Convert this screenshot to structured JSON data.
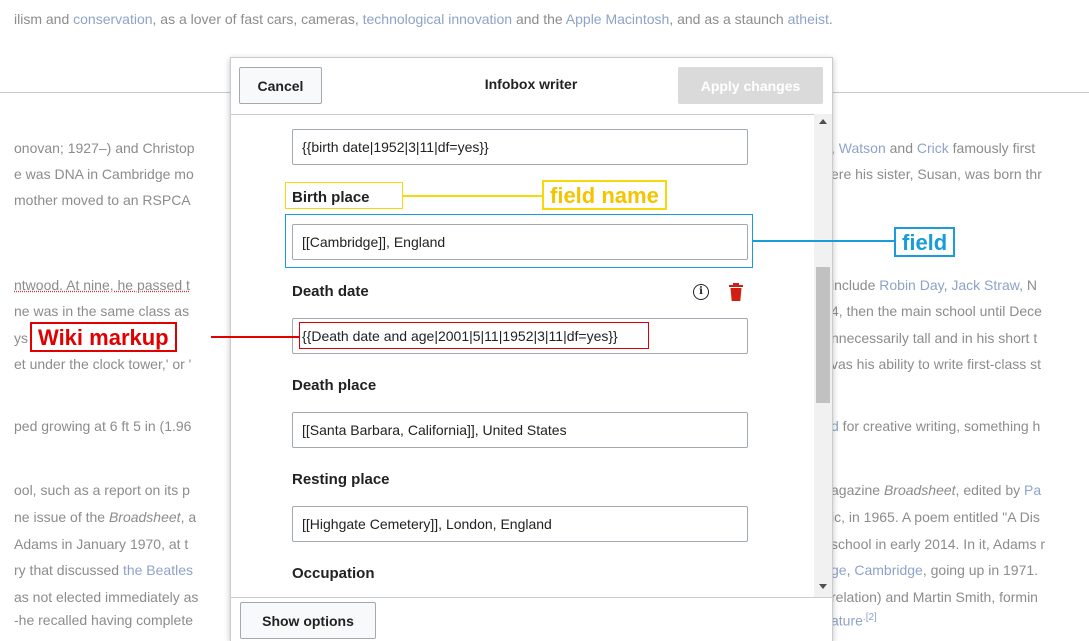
{
  "background": {
    "top_line": [
      {
        "t": "ilism and ",
        "l": false
      },
      {
        "t": "conservation",
        "l": true
      },
      {
        "t": ", as a lover of fast cars, cameras, ",
        "l": false
      },
      {
        "t": "technological innovation",
        "l": true
      },
      {
        "t": " and the ",
        "l": false
      },
      {
        "t": "Apple Macintosh",
        "l": true
      },
      {
        "t": ", and as a staunch ",
        "l": false
      },
      {
        "t": "atheist",
        "l": true
      },
      {
        "t": ".",
        "l": false
      }
    ],
    "left": [
      "onovan; 1927–) and Christop",
      "e was DNA in Cambridge mo",
      " mother moved to an ",
      "ntwood. At nine, he passed t",
      "ne was in the same class as",
      "ys",
      "et under the clock tower,' or '",
      "ped growing at 6 ft 5 in (1.96",
      "ool, such as a report on its p",
      "ne issue of the ",
      " Adams in January 1970, at t",
      "ry that discussed ",
      "as not elected immediately as",
      "-he recalled having complete"
    ],
    "left_rspca": "RSPCA",
    "left_broadsheet": "Broadsheet",
    "left_broadsheet_after": ", a",
    "left_beatles": "the Beatles",
    "right": {
      "r1_pre": ", ",
      "r1_a": "Watson",
      "r1_b": " and ",
      "r1_c": "Crick",
      "r1_d": " famously first",
      "r2": "ere his sister, Susan, was born thr",
      "r4_pre": " include ",
      "r4_a": "Robin Day",
      "r4_b": ", ",
      "r4_c": "Jack Straw",
      "r4_d": ", N",
      "r5": "4, then the main school until Dece",
      "r6": "nnecessarily tall and in his short t",
      "r7": "vas his ability to write first-class st",
      "r8_a": "d",
      "r8_b": " for creative writing, something h",
      "r9_a": "agazine ",
      "r9_b": "Broadsheet",
      "r9_c": ", edited by ",
      "r9_d": "Pa",
      "r10": "ic, in 1965. A poem entitled \"A Dis",
      "r11": "school in early 2014. In it, Adams r",
      "r12_a": "ge",
      "r12_b": ", ",
      "r12_c": "Cambridge",
      "r12_d": ", going up in 1971.",
      "r13": " relation) and Martin Smith, formin",
      "r14_a": "ature",
      "r14_b": ".[2]"
    }
  },
  "dialog": {
    "cancel_label": "Cancel",
    "title": "Infobox writer",
    "apply_label": "Apply changes",
    "show_options_label": "Show options",
    "fields": [
      {
        "label": "",
        "value": "{{birth date|1952|3|11|df=yes}}"
      },
      {
        "label": "Birth place",
        "value": "[[Cambridge]], England"
      },
      {
        "label": "Death date",
        "value": "{{Death date and age|2001|5|11|1952|3|11|df=yes}}"
      },
      {
        "label": "Death place",
        "value": "[[Santa Barbara, California]], United States"
      },
      {
        "label": "Resting place",
        "value": "[[Highgate Cemetery]], London, England"
      },
      {
        "label": "Occupation",
        "value": ""
      }
    ]
  },
  "annotations": {
    "field_name": "field name",
    "field": "field",
    "wiki_markup": "Wiki markup"
  },
  "colors": {
    "field_name": "#f5d90a",
    "field": "#1a9cd8",
    "wiki_markup": "#e00000",
    "delete_icon": "#d11d13",
    "link": "#8ea3c7"
  },
  "icons": [
    "info-icon",
    "trash-icon",
    "scroll-up-icon",
    "scroll-down-icon"
  ]
}
